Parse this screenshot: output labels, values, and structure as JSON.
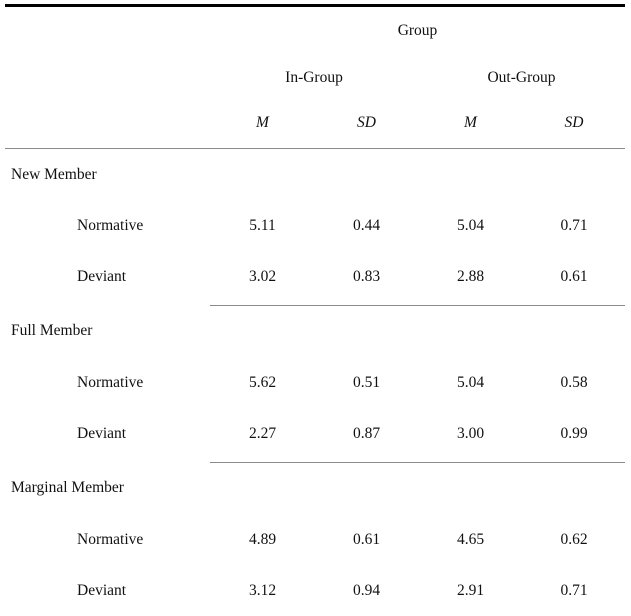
{
  "table": {
    "spanning_header": "Group",
    "column_groups": [
      "In-Group",
      "Out-Group"
    ],
    "stat_headers": [
      "M",
      "SD",
      "M",
      "SD"
    ],
    "blocks": [
      {
        "label": "New Member",
        "rows": [
          {
            "label": "Normative",
            "values": [
              "5.11",
              "0.44",
              "5.04",
              "0.71"
            ]
          },
          {
            "label": "Deviant",
            "values": [
              "3.02",
              "0.83",
              "2.88",
              "0.61"
            ]
          }
        ]
      },
      {
        "label": "Full Member",
        "rows": [
          {
            "label": "Normative",
            "values": [
              "5.62",
              "0.51",
              "5.04",
              "0.58"
            ]
          },
          {
            "label": "Deviant",
            "values": [
              "2.27",
              "0.87",
              "3.00",
              "0.99"
            ]
          }
        ]
      },
      {
        "label": "Marginal Member",
        "rows": [
          {
            "label": "Normative",
            "values": [
              "4.89",
              "0.61",
              "4.65",
              "0.62"
            ]
          },
          {
            "label": "Deviant",
            "values": [
              "3.12",
              "0.94",
              "2.91",
              "0.71"
            ]
          }
        ]
      }
    ]
  },
  "chart_data": {
    "type": "table",
    "title": "Group",
    "row_groups": [
      "New Member",
      "Full Member",
      "Marginal Member"
    ],
    "row_subcategories": [
      "Normative",
      "Deviant"
    ],
    "column_groups": [
      "In-Group",
      "Out-Group"
    ],
    "statistics": [
      "M",
      "SD"
    ],
    "categories": [
      "New Member / Normative",
      "New Member / Deviant",
      "Full Member / Normative",
      "Full Member / Deviant",
      "Marginal Member / Normative",
      "Marginal Member / Deviant"
    ],
    "series": [
      {
        "name": "In-Group M",
        "values": [
          5.11,
          3.02,
          5.62,
          2.27,
          4.89,
          3.12
        ]
      },
      {
        "name": "In-Group SD",
        "values": [
          0.44,
          0.83,
          0.51,
          0.87,
          0.61,
          0.94
        ]
      },
      {
        "name": "Out-Group M",
        "values": [
          5.04,
          2.88,
          5.04,
          3.0,
          4.65,
          2.91
        ]
      },
      {
        "name": "Out-Group SD",
        "values": [
          0.71,
          0.61,
          0.58,
          0.99,
          0.62,
          0.71
        ]
      }
    ]
  }
}
